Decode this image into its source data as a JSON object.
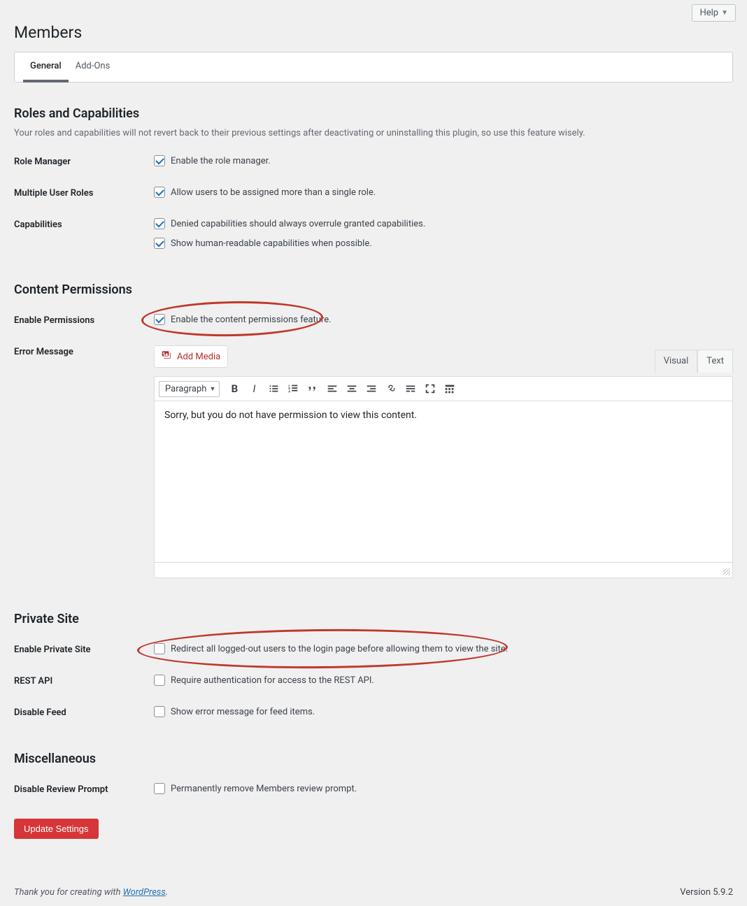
{
  "help_label": "Help",
  "page_title": "Members",
  "tabs": {
    "general": "General",
    "addons": "Add-Ons"
  },
  "roles": {
    "heading": "Roles and Capabilities",
    "desc": "Your roles and capabilities will not revert back to their previous settings after deactivating or uninstalling this plugin, so use this feature wisely.",
    "role_manager_label": "Role Manager",
    "role_manager_check": "Enable the role manager.",
    "multiple_label": "Multiple User Roles",
    "multiple_check": "Allow users to be assigned more than a single role.",
    "caps_label": "Capabilities",
    "caps_check1": "Denied capabilities should always overrule granted capabilities.",
    "caps_check2": "Show human-readable capabilities when possible."
  },
  "content": {
    "heading": "Content Permissions",
    "enable_label": "Enable Permissions",
    "enable_check": "Enable the content permissions feature.",
    "error_label": "Error Message",
    "add_media": "Add Media",
    "visual_tab": "Visual",
    "text_tab": "Text",
    "format": "Paragraph",
    "body": "Sorry, but you do not have permission to view this content."
  },
  "private": {
    "heading": "Private Site",
    "enable_label": "Enable Private Site",
    "enable_check": "Redirect all logged-out users to the login page before allowing them to view the site.",
    "rest_label": "REST API",
    "rest_check": "Require authentication for access to the REST API.",
    "feed_label": "Disable Feed",
    "feed_check": "Show error message for feed items."
  },
  "misc": {
    "heading": "Miscellaneous",
    "review_label": "Disable Review Prompt",
    "review_check": "Permanently remove Members review prompt."
  },
  "submit": "Update Settings",
  "footer": {
    "thanks": "Thank you for creating with ",
    "wp": "WordPress",
    "dot": ".",
    "version": "Version 5.9.2"
  }
}
